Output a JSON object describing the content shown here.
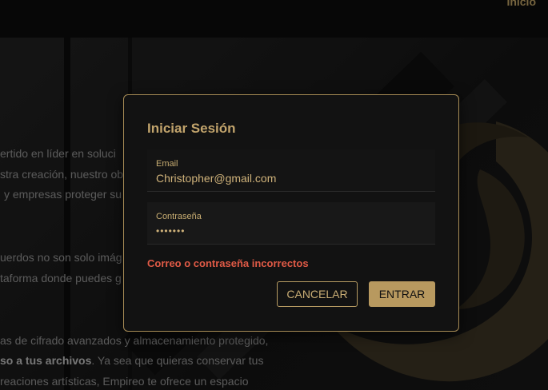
{
  "nav": {
    "link": "Inicio"
  },
  "background_text": {
    "line1": "ertido en líder en soluci",
    "line2": "stra creación, nuestro ob",
    "line3": "y empresas proteger su",
    "line4": "uerdos no son solo imág",
    "line5": "taforma donde puedes g",
    "line6": "as de cifrado avanzados y almacenamiento protegido,",
    "line7_bold": "so a tus archivos",
    "line7_rest": ". Ya sea que quieras conservar tus",
    "line8": "reaciones artísticas, Empireo te ofrece un espacio"
  },
  "dialog": {
    "title": "Iniciar Sesión",
    "email_label": "Email",
    "email_value": "Christopher@gmail.com",
    "password_label": "Contraseña",
    "password_value": "•••••••",
    "error": "Correo o contraseña incorrectos",
    "cancel_label": "CANCELAR",
    "submit_label": "ENTRAR"
  },
  "colors": {
    "accent": "#b8995f",
    "error": "#e05a46",
    "dialog_bg": "#121212"
  }
}
